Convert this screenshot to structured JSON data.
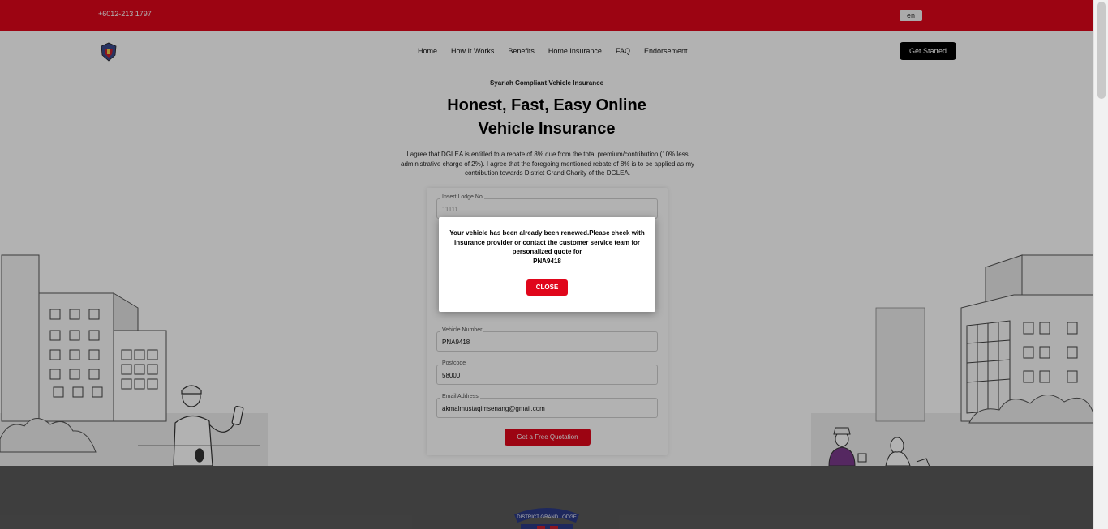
{
  "topbar": {
    "phone": "+6012-213 1797",
    "language": "en"
  },
  "nav": {
    "items": [
      "Home",
      "How It Works",
      "Benefits",
      "Home Insurance",
      "FAQ",
      "Endorsement"
    ],
    "cta_label": "Get Started"
  },
  "hero": {
    "tag": "Syariah Compliant Vehicle Insurance",
    "title_line1": "Honest, Fast, Easy Online",
    "title_line2": "Vehicle Insurance",
    "description": "I agree that DGLEA is entitled to a rebate of 8% due from the total premium/contribution (10% less administrative charge of 2%). I agree that the foregoing mentioned rebate of 8% is to be applied as my contribution towards District Grand Charity of the DGLEA."
  },
  "form": {
    "lodge_label": "Insert Lodge No",
    "lodge_value": "11111",
    "vehicle_label": "Vehicle Number",
    "vehicle_value": "PNA9418",
    "postcode_label": "Postcode",
    "postcode_value": "58000",
    "email_label": "Email Address",
    "email_value": "akmalmustaqimsenang@gmail.com",
    "submit_label": "Get a Free Quotation"
  },
  "banner": {
    "badge_text": "DISTRICT GRAND LODGE"
  },
  "modal": {
    "message": "Your vehicle has been already been renewed.Please check with insurance provider or contact the customer service team for personalized quote for",
    "plate": "PNA9418",
    "close_label": "CLOSE"
  },
  "colors": {
    "brand_red": "#e0061b",
    "black": "#000000"
  }
}
